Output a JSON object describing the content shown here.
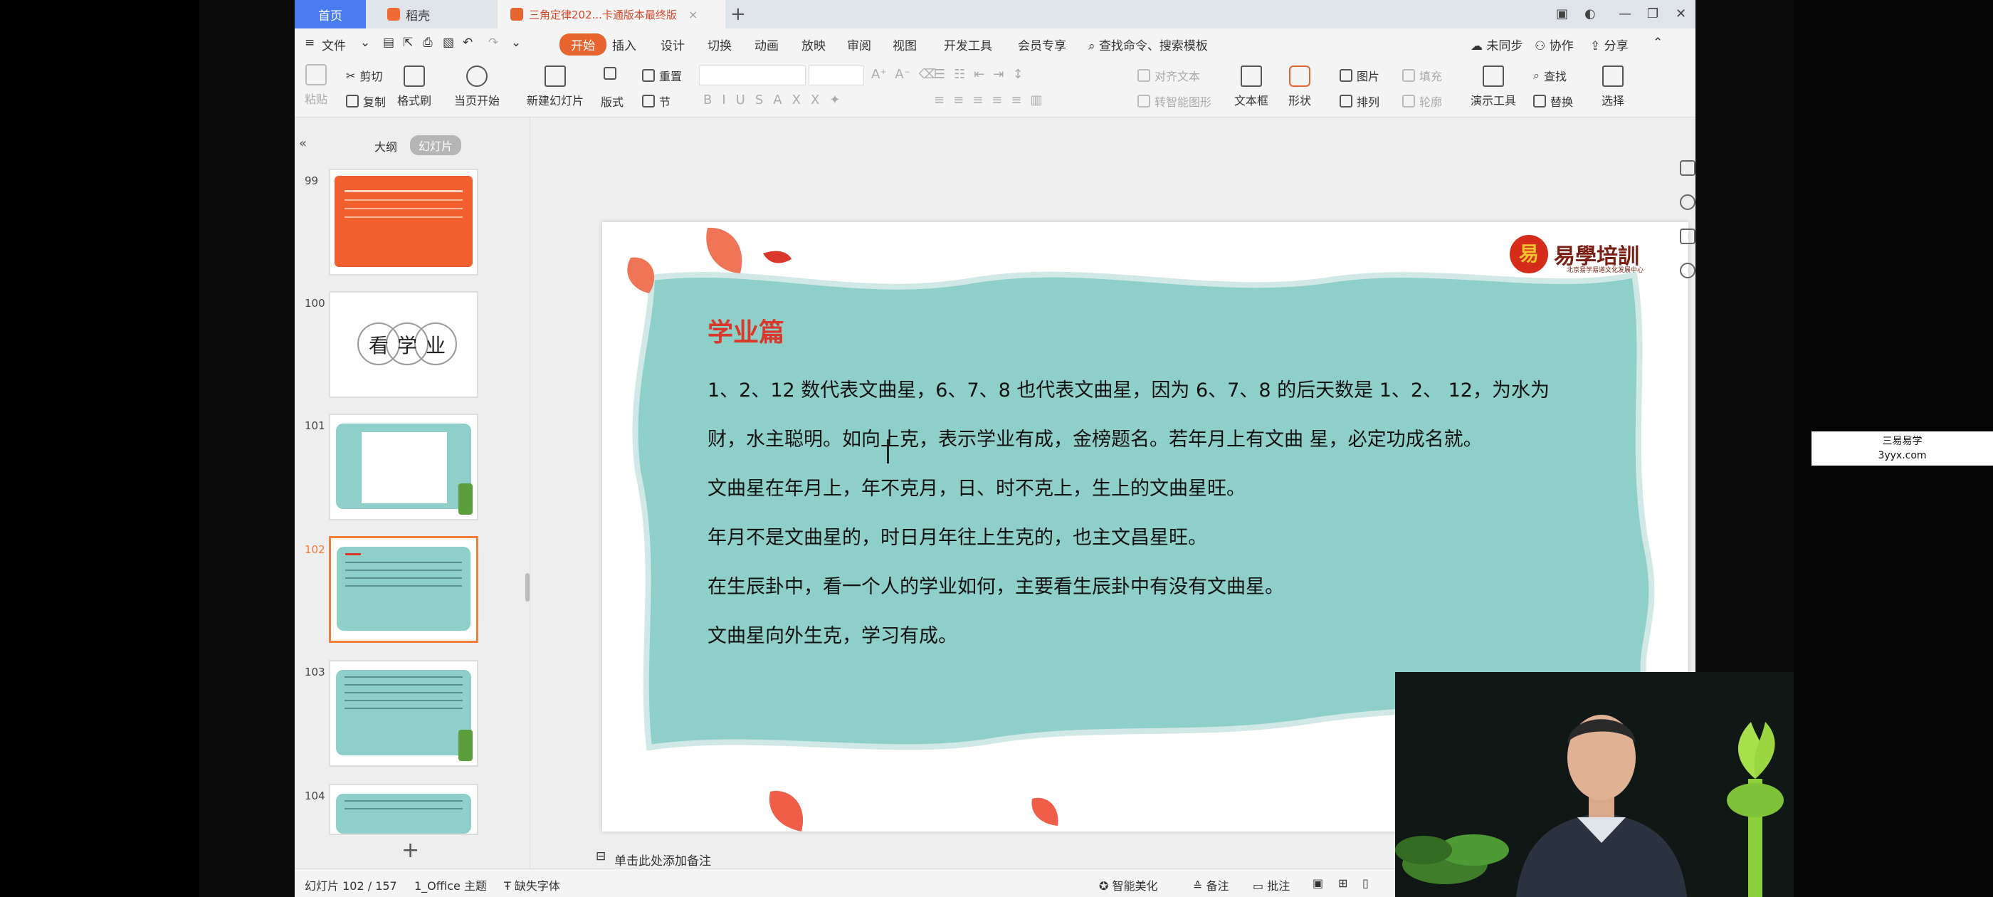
{
  "tabs": {
    "home": "首页",
    "wps": "稻壳",
    "doc": "三角定律202...卡通版本最终版"
  },
  "menu": {
    "file": "文件",
    "items": [
      "开始",
      "插入",
      "设计",
      "切换",
      "动画",
      "放映",
      "审阅",
      "视图",
      "开发工具",
      "会员专享"
    ],
    "search": "查找命令、搜索模板",
    "sync": "未同步",
    "collab": "协作",
    "share": "分享"
  },
  "ribbon": {
    "paste": "粘贴",
    "cut": "剪切",
    "copy": "复制",
    "format_painter": "格式刷",
    "play_from_current": "当页开始",
    "new_slide": "新建幻灯片",
    "layout": "版式",
    "section": "节",
    "reset": "重置",
    "align_text": "对齐文本",
    "convert_smartart": "转智能图形",
    "textbox": "文本框",
    "shape": "形状",
    "picture": "图片",
    "arrange": "排列",
    "fill": "填充",
    "outline": "轮廓",
    "presentation_tools": "演示工具",
    "find": "查找",
    "replace": "替换",
    "select": "选择"
  },
  "left_pane": {
    "tab_outline": "大纲",
    "tab_slides": "幻灯片",
    "slide_numbers": [
      "99",
      "100",
      "101",
      "102",
      "103",
      "104"
    ],
    "thumb_100_title_chars": [
      "看",
      "学",
      "业"
    ]
  },
  "slide": {
    "heading": "学业篇",
    "paragraphs": [
      "1、2、12 数代表文曲星，6、7、8 也代表文曲星，因为 6、7、8 的后天数是 1、2、 12，为水为财，水主聪明。如向上克，表示学业有成，金榜题名。若年月上有文曲 星，必定功成名就。",
      "文曲星在年月上，年不克月，日、时不克上，生上的文曲星旺。",
      "年月不是文曲星的，时日月年往上生克的，也主文昌星旺。",
      "在生辰卦中，看一个人的学业如何，主要看生辰卦中有没有文曲星。",
      "文曲星向外生克，学习有成。"
    ],
    "brand_name": "易學培訓",
    "brand_logo_char": "易",
    "brand_sub": "北京易学易道文化发展中心"
  },
  "notes_placeholder": "单击此处添加备注",
  "status": {
    "slide_info": "幻灯片 102 / 157",
    "theme": "1_Office 主题",
    "missing_font": "缺失字体",
    "smart_beautify": "智能美化",
    "notes": "备注",
    "comments": "批注"
  },
  "watermark": {
    "line1": "三易易学",
    "line2": "3yyx.com"
  },
  "colors": {
    "accent": "#e8652f",
    "teal_bg": "#8fcfca",
    "heading_red": "#d9382b",
    "tab_blue": "#4a7cf0"
  }
}
